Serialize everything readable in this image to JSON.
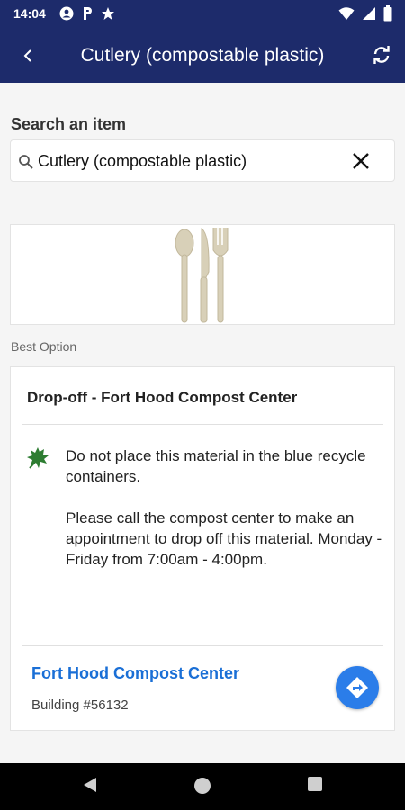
{
  "status_bar": {
    "time": "14:04",
    "left_icons": [
      "account-circle-icon",
      "parking-icon",
      "star-icon"
    ],
    "right_icons": [
      "wifi-icon",
      "signal-icon",
      "battery-icon"
    ]
  },
  "app_bar": {
    "title": "Cutlery (compostable plastic)",
    "back_icon": "back-arrow-icon",
    "refresh_icon": "refresh-icon",
    "background_color": "#1d2b6b"
  },
  "search": {
    "label": "Search an item",
    "value": "Cutlery (compostable plastic)",
    "search_icon": "search-icon",
    "clear_icon": "close-icon"
  },
  "item_image": {
    "icon": "cutlery-image"
  },
  "best_option": {
    "label": "Best Option",
    "heading": "Drop-off - Fort Hood Compost Center",
    "icon": "leaf-icon",
    "description": "Do not place this material in the blue recycle containers.\n\nPlease call the compost center to make an appointment to drop off this material.  Monday - Friday from 7:00am - 4:00pm.",
    "location_name": "Fort Hood Compost Center",
    "location_address": "Building #56132",
    "directions_icon": "directions-icon",
    "link_color": "#1a6fd6",
    "button_color": "#2b7de9"
  },
  "nav_bar": {
    "icons": [
      "nav-back-icon",
      "nav-home-icon",
      "nav-recents-icon"
    ]
  }
}
